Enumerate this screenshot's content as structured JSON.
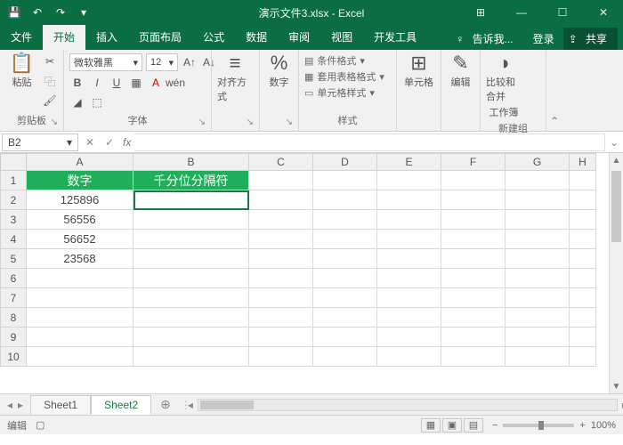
{
  "title": "演示文件3.xlsx - Excel",
  "tabs": {
    "file": "文件",
    "home": "开始",
    "insert": "插入",
    "layout": "页面布局",
    "formula": "公式",
    "data": "数据",
    "review": "审阅",
    "view": "视图",
    "dev": "开发工具",
    "tell": "告诉我...",
    "login": "登录",
    "share": "共享"
  },
  "ribbon": {
    "clipboard": {
      "paste": "粘贴",
      "label": "剪贴板"
    },
    "font": {
      "name": "微软雅黑",
      "size": "12",
      "label": "字体",
      "bold": "B",
      "italic": "I",
      "underline": "U"
    },
    "align": {
      "label": "对齐方式"
    },
    "number": {
      "btn": "数字",
      "label": "数字",
      "pct": "%"
    },
    "styles": {
      "cond": "条件格式",
      "tablefmt": "套用表格格式",
      "cellfmt": "单元格样式",
      "label": "样式"
    },
    "cells": {
      "btn": "单元格"
    },
    "editing": {
      "btn": "编辑"
    },
    "compare": {
      "l1": "比较和合并",
      "l2": "工作簿",
      "label": "新建组"
    }
  },
  "namebox": "B2",
  "fx": "fx",
  "cols": [
    "A",
    "B",
    "C",
    "D",
    "E",
    "F",
    "G",
    "H"
  ],
  "rows": [
    "1",
    "2",
    "3",
    "4",
    "5",
    "6",
    "7",
    "8",
    "9",
    "10"
  ],
  "data": {
    "A1": "数字",
    "B1": "千分位分隔符",
    "A2": "125896",
    "A3": "56556",
    "A4": "56652",
    "A5": "23568"
  },
  "sheets": {
    "s1": "Sheet1",
    "s2": "Sheet2"
  },
  "status": {
    "mode": "编辑",
    "zoom": "100%"
  }
}
